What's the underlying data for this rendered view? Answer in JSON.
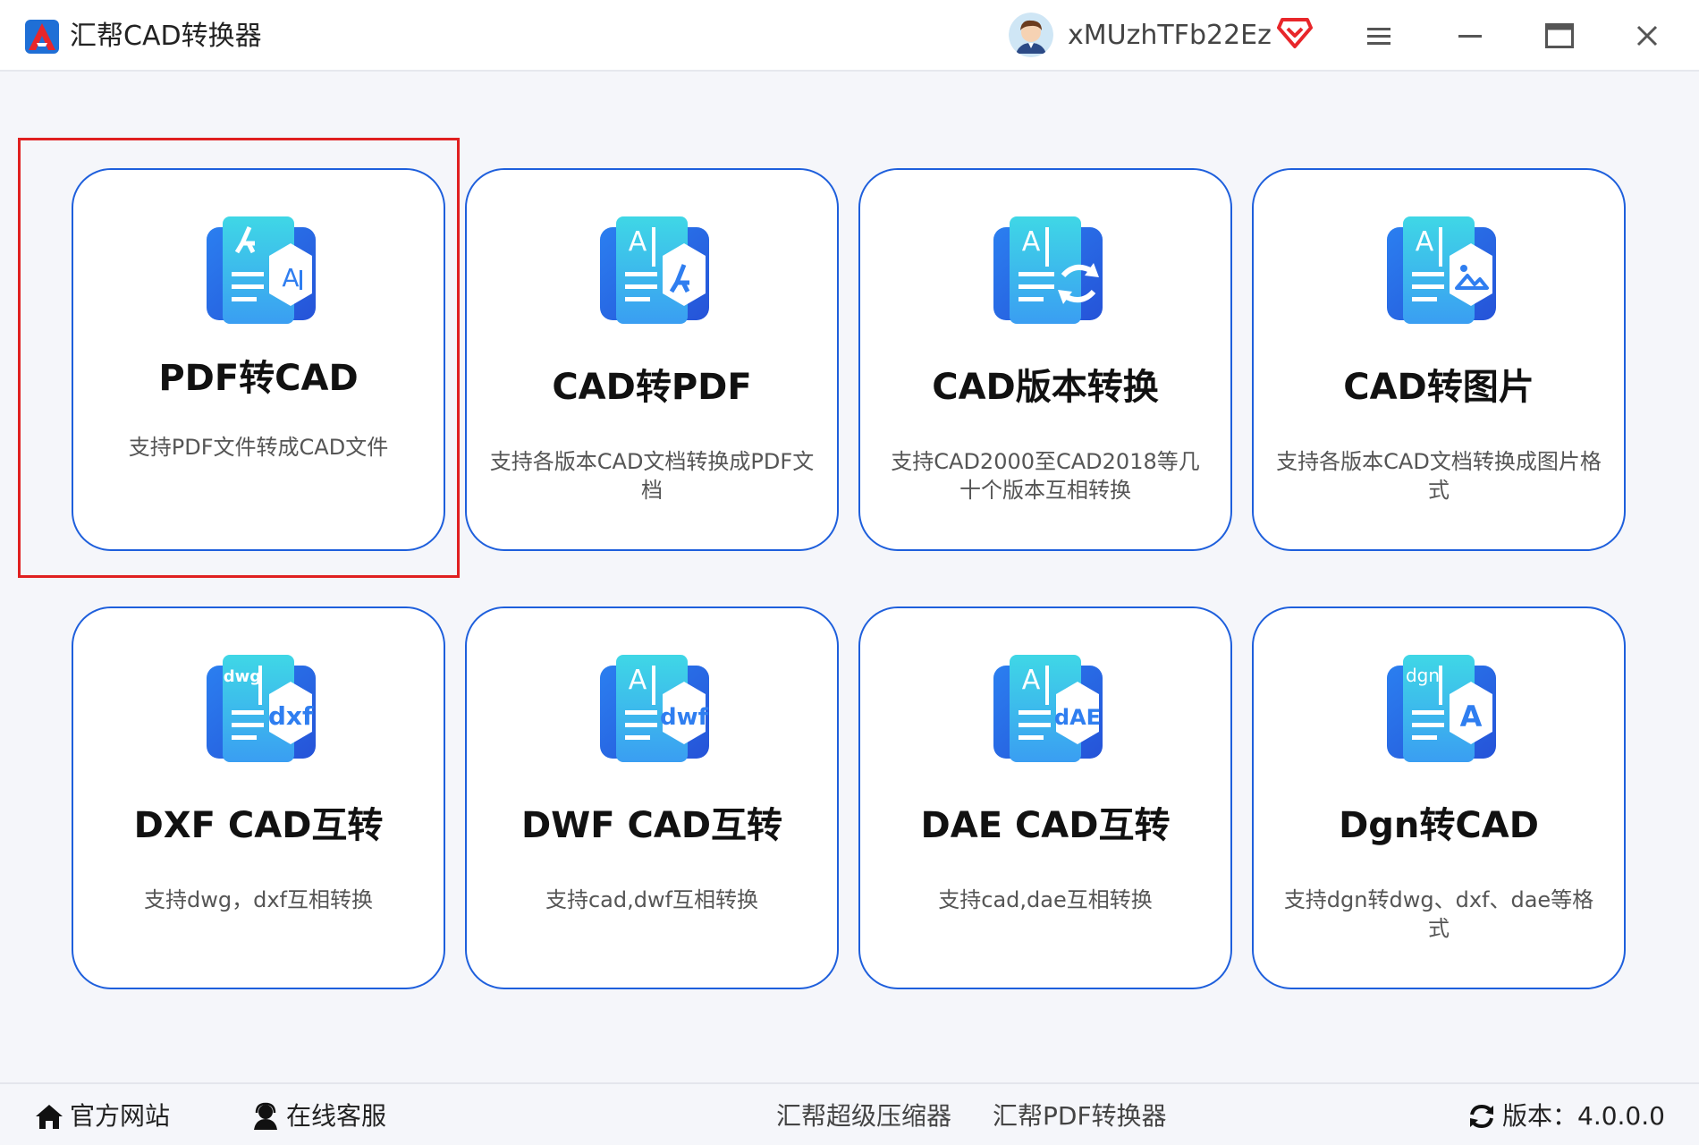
{
  "app": {
    "title": "汇帮CAD转换器"
  },
  "header": {
    "username": "xMUzhTFb22Ez",
    "avatar_icon": "user-avatar-icon",
    "vip_icon": "vip-diamond-icon",
    "menu_icon": "hamburger-menu-icon",
    "minimize_icon": "minimize-icon",
    "maximize_icon": "maximize-icon",
    "close_icon": "close-icon"
  },
  "cards": [
    {
      "title": "PDF转CAD",
      "desc": "支持PDF文件转成CAD文件",
      "icon": "pdf-to-cad-icon",
      "badge": ""
    },
    {
      "title": "CAD转PDF",
      "desc": "支持各版本CAD文档转换成PDF文档",
      "icon": "cad-to-pdf-icon",
      "badge": ""
    },
    {
      "title": "CAD版本转换",
      "desc": "支持CAD2000至CAD2018等几十个版本互相转换",
      "icon": "cad-version-convert-icon",
      "badge": ""
    },
    {
      "title": "CAD转图片",
      "desc": "支持各版本CAD文档转换成图片格式",
      "icon": "cad-to-image-icon",
      "badge": ""
    },
    {
      "title": "DXF CAD互转",
      "desc": "支持dwg，dxf互相转换",
      "icon": "dxf-cad-icon",
      "badge": "dwg",
      "badge2": "dxf"
    },
    {
      "title": "DWF CAD互转",
      "desc": "支持cad,dwf互相转换",
      "icon": "dwf-cad-icon",
      "badge": "dwf"
    },
    {
      "title": "DAE CAD互转",
      "desc": "支持cad,dae互相转换",
      "icon": "dae-cad-icon",
      "badge": "dAE"
    },
    {
      "title": "Dgn转CAD",
      "desc": "支持dgn转dwg、dxf、dae等格式",
      "icon": "dgn-to-cad-icon",
      "badge": "dgn",
      "badge2": "A"
    }
  ],
  "footer": {
    "official_site": "官方网站",
    "online_service": "在线客服",
    "compressor": "汇帮超级压缩器",
    "pdf_converter": "汇帮PDF转换器",
    "version": "版本：4.0.0.0"
  },
  "colors": {
    "accent": "#1e5fdc",
    "highlight": "#e02020",
    "icon_gradient_start": "#3ad6e0",
    "icon_gradient_end": "#2f6cf0"
  }
}
